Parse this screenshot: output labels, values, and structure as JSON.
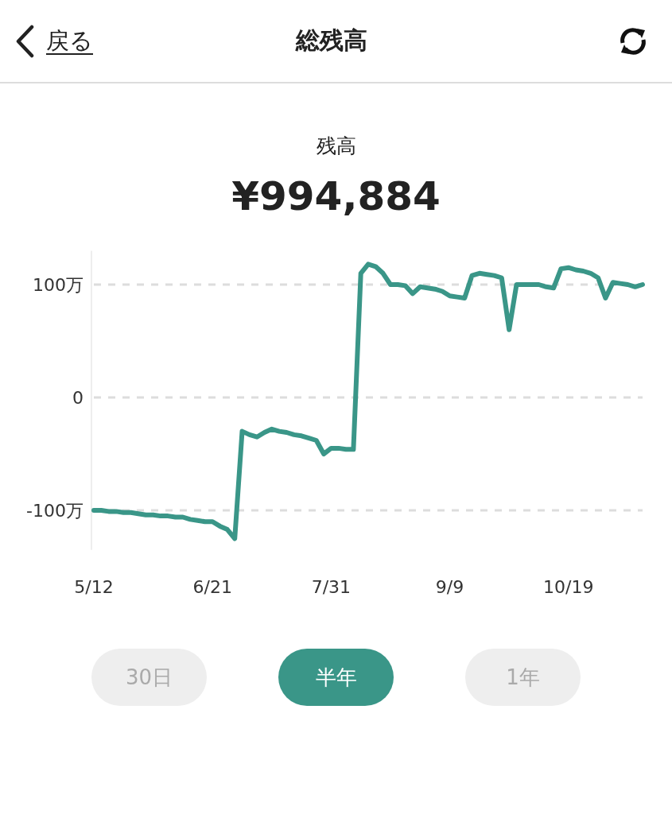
{
  "header": {
    "back_label": "戻る",
    "title": "総残高"
  },
  "balance": {
    "label": "残高",
    "amount": "¥994,884"
  },
  "chart": {
    "chart_data": {
      "type": "line",
      "categories": [
        "5/12",
        null,
        null,
        null,
        null,
        null,
        null,
        null,
        null,
        null,
        null,
        null,
        null,
        null,
        null,
        null,
        "6/21",
        null,
        null,
        null,
        null,
        null,
        null,
        null,
        null,
        null,
        null,
        null,
        null,
        null,
        null,
        null,
        "7/31",
        null,
        null,
        null,
        null,
        null,
        null,
        null,
        null,
        null,
        null,
        null,
        null,
        null,
        null,
        null,
        "9/9",
        null,
        null,
        null,
        null,
        null,
        null,
        null,
        null,
        null,
        null,
        null,
        null,
        null,
        null,
        null,
        "10/19",
        null,
        null,
        null,
        null,
        null,
        null,
        null,
        null,
        null,
        null
      ],
      "series": [
        {
          "color": "#3a9688",
          "values": [
            -100,
            -100,
            -101,
            -101,
            -102,
            -102,
            -103,
            -104,
            -104,
            -105,
            -105,
            -106,
            -106,
            -108,
            -109,
            -110,
            -110,
            -114,
            -117,
            -125,
            -30,
            -33,
            -35,
            -31,
            -28,
            -30,
            -31,
            -33,
            -34,
            -36,
            -38,
            -50,
            -45,
            -45,
            -46,
            -46,
            110,
            118,
            116,
            110,
            100,
            100,
            99,
            92,
            98,
            97,
            96,
            94,
            90,
            89,
            88,
            108,
            110,
            109,
            108,
            106,
            60,
            100,
            100,
            100,
            100,
            98,
            97,
            114,
            115,
            113,
            112,
            110,
            106,
            88,
            102,
            101,
            100,
            98,
            100
          ]
        }
      ],
      "grid": true,
      "ylim": [
        -135,
        130
      ],
      "yticks": [
        {
          "value": -100,
          "label": "-100万"
        },
        {
          "value": 0,
          "label": "0"
        },
        {
          "value": 100,
          "label": "100万"
        }
      ]
    }
  },
  "periods": [
    {
      "label": "30日",
      "selected": false
    },
    {
      "label": "半年",
      "selected": true
    },
    {
      "label": "1年",
      "selected": false
    }
  ]
}
